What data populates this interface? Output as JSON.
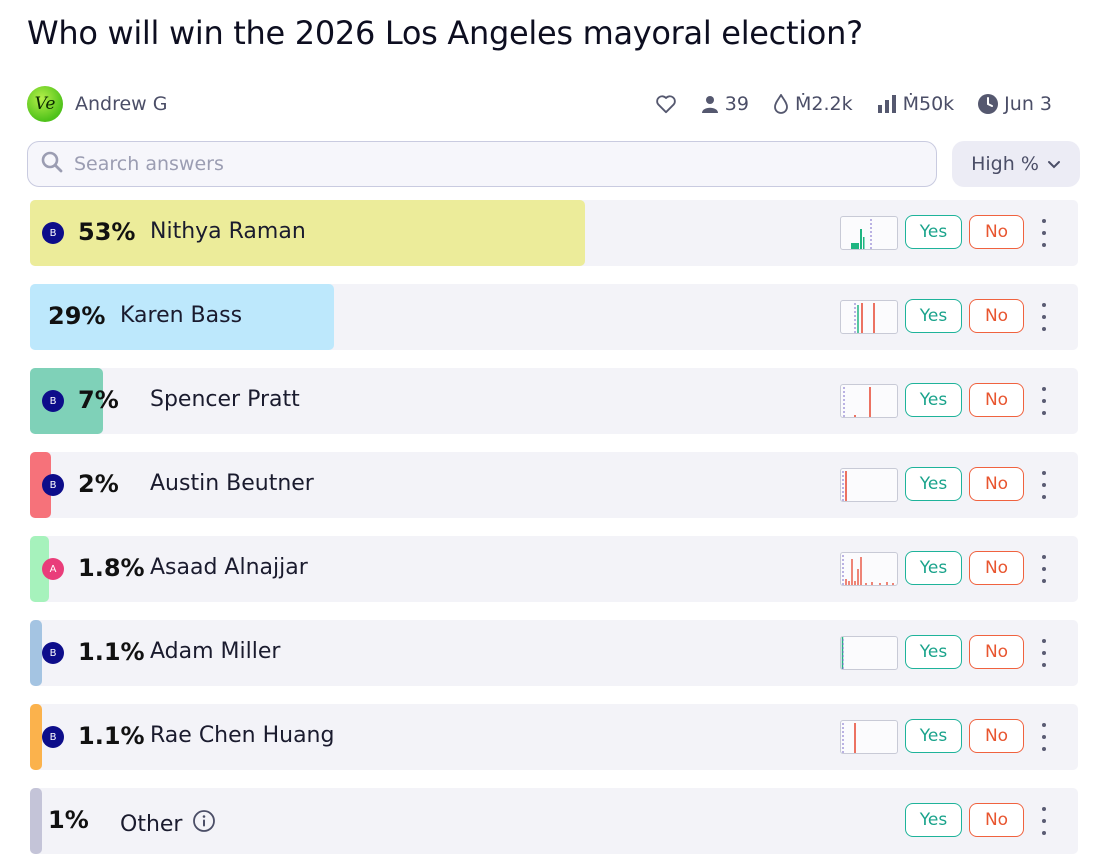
{
  "page": {
    "title": "Who will win the 2026 Los Angeles mayoral election?"
  },
  "author": {
    "avatar_text": "Ve",
    "name": "Andrew G"
  },
  "stats": {
    "traders": "39",
    "liquidity": "Ṁ2.2k",
    "volume": "Ṁ50k",
    "close_date": "Jun 3",
    "icons": [
      "heart-icon",
      "user-icon",
      "droplet-icon",
      "bar-chart-icon",
      "clock-icon"
    ]
  },
  "search": {
    "placeholder": "Search answers",
    "value": ""
  },
  "sort": {
    "label": "High %"
  },
  "colors": {
    "yes": "#1aa38b",
    "no": "#e8552f",
    "badge_b": "#0d0d8a",
    "badge_a": "#e93d7a"
  },
  "answers": [
    {
      "pct_label": "53%",
      "name": "Nithya Raman",
      "probability": 0.53,
      "bar_color": "#ecec9a",
      "badge": "B",
      "badge_color": "#0d0d8a",
      "yes": "Yes",
      "no": "No"
    },
    {
      "pct_label": "29%",
      "name": "Karen Bass",
      "probability": 0.29,
      "bar_color": "#bde8fc",
      "badge": "",
      "badge_color": "",
      "yes": "Yes",
      "no": "No"
    },
    {
      "pct_label": "7%",
      "name": "Spencer Pratt",
      "probability": 0.07,
      "bar_color": "#7fd1b8",
      "badge": "B",
      "badge_color": "#0d0d8a",
      "yes": "Yes",
      "no": "No"
    },
    {
      "pct_label": "2%",
      "name": "Austin Beutner",
      "probability": 0.02,
      "bar_color": "#f6727a",
      "badge": "B",
      "badge_color": "#0d0d8a",
      "yes": "Yes",
      "no": "No"
    },
    {
      "pct_label": "1.8%",
      "name": "Asaad Alnajjar",
      "probability": 0.018,
      "bar_color": "#a6f2bc",
      "badge": "A",
      "badge_color": "#e93d7a",
      "yes": "Yes",
      "no": "No"
    },
    {
      "pct_label": "1.1%",
      "name": "Adam Miller",
      "probability": 0.011,
      "bar_color": "#a4c4e2",
      "badge": "B",
      "badge_color": "#0d0d8a",
      "yes": "Yes",
      "no": "No"
    },
    {
      "pct_label": "1.1%",
      "name": "Rae Chen Huang",
      "probability": 0.011,
      "bar_color": "#fbb24c",
      "badge": "B",
      "badge_color": "#0d0d8a",
      "yes": "Yes",
      "no": "No"
    },
    {
      "pct_label": "1%",
      "name": "Other",
      "probability": 0.01,
      "bar_color": "#c4c4d8",
      "badge": "",
      "badge_color": "",
      "yes": "Yes",
      "no": "No",
      "info_icon": "info-icon"
    }
  ]
}
